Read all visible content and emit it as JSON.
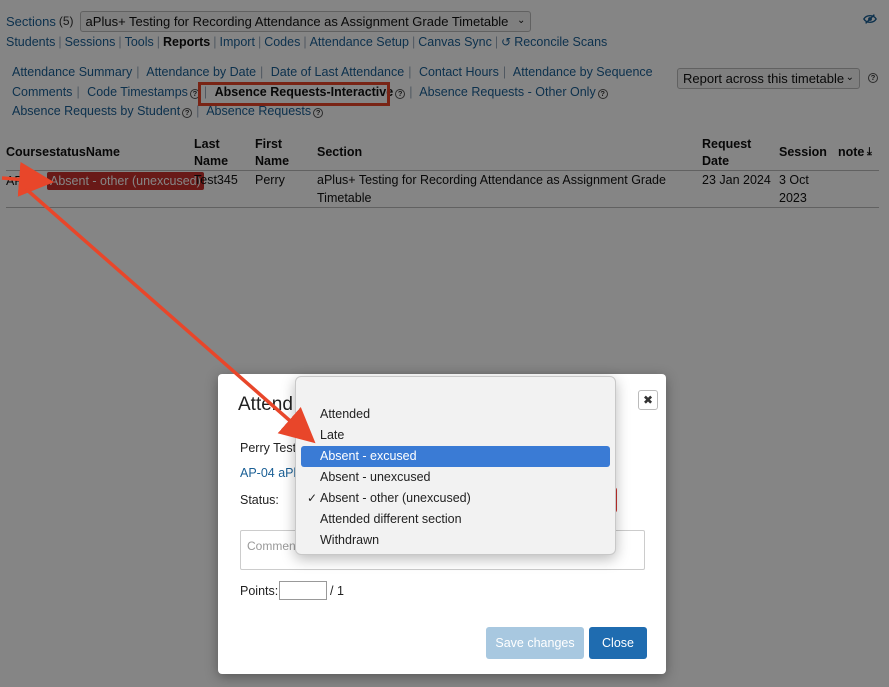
{
  "header": {
    "sections_label": "Sections",
    "sections_count": "(5)",
    "timetable": "aPlus+ Testing for Recording Attendance as Assignment Grade Timetable"
  },
  "nav": {
    "items": [
      "Students",
      "Sessions",
      "Tools",
      "Reports",
      "Import",
      "Codes",
      "Attendance Setup",
      "Canvas Sync",
      "Reconcile Scans"
    ],
    "current": "Reports"
  },
  "report_tabs": {
    "attendance_summary": "Attendance Summary",
    "attendance_by_date": "Attendance by Date",
    "date_of_last_attendance": "Date of Last Attendance",
    "contact_hours": "Contact Hours",
    "attendance_by_sequence": "Attendance by Sequence",
    "comments": "Comments",
    "code_timestamps": "Code Timestamps",
    "absence_requests_interactive": "Absence Requests-Interactive",
    "absence_requests_other_only": "Absence Requests - Other Only",
    "absence_requests_by_student": "Absence Requests by Student",
    "absence_requests": "Absence Requests"
  },
  "report_across": "Report across this timetable",
  "table": {
    "headers": {
      "course": "CoursestatusName",
      "last_name_1": "Last",
      "last_name_2": "Name",
      "first_name_1": "First",
      "first_name_2": "Name",
      "section": "Section",
      "request_date_1": "Request",
      "request_date_2": "Date",
      "session": "Session",
      "note": "note"
    },
    "row": {
      "course": "AP",
      "status": "Absent - other (unexcused)",
      "last_name": "Test345",
      "first_name": "Perry",
      "section_1": "aPlus+ Testing for Recording Attendance as Assignment Grade",
      "section_2": "Timetable",
      "request_date": "23 Jan 2024",
      "session_1": "3 Oct",
      "session_2": "2023"
    }
  },
  "modal": {
    "title": "Attend",
    "student": "Perry Test",
    "course": "AP-04 aPlu",
    "status_label": "Status:",
    "comment_placeholder": "Commen",
    "points_label": "Points:",
    "points_value": "",
    "points_total": "/ 1",
    "save_label": "Save changes",
    "close_label": "Close"
  },
  "dropdown": {
    "options": [
      "Attended",
      "Late",
      "Absent - excused",
      "Absent - unexcused",
      "Absent - other (unexcused)",
      "Attended different section",
      "Withdrawn"
    ],
    "highlighted": "Absent - excused",
    "selected": "Absent - other (unexcused)"
  },
  "colors": {
    "link": "#1a5f95",
    "highlight_box": "#e8462a",
    "status_red": "#c9302c",
    "primary_button": "#1f6cb0",
    "disabled_button": "#a8c8e0",
    "hover_option": "#3a7bd5"
  }
}
